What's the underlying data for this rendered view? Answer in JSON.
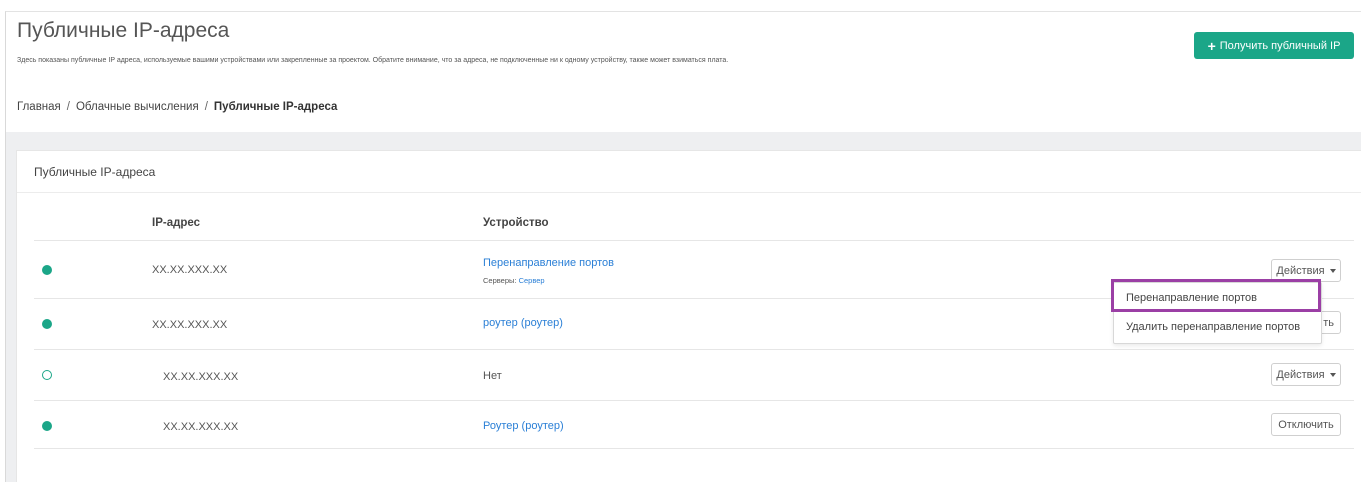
{
  "page": {
    "title": "Публичные IP-адреса",
    "description": "Здесь показаны публичные IP адреса, используемые вашими устройствами или закрепленные за проектом. Обратите внимание, что за адреса, не подключенные ни к одному устройству, также может взиматься плата.",
    "get_ip_button": "Получить публичный IP"
  },
  "breadcrumb": {
    "items": [
      "Главная",
      "Облачные вычисления",
      "Публичные IP-адреса"
    ],
    "separator": "/"
  },
  "panel": {
    "title": "Публичные IP-адреса",
    "columns": [
      "IP-адрес",
      "Устройство"
    ]
  },
  "rows": [
    {
      "status": "active",
      "ip": "XX.XX.XXX.XX",
      "device": "Перенаправление портов",
      "device_sub_label": "Серверы:",
      "device_sub_link": "Сервер",
      "action": "Действия"
    },
    {
      "status": "active",
      "ip": "XX.XX.XXX.XX",
      "device": "роутер (роутер)",
      "action": "ть"
    },
    {
      "status": "inactive",
      "ip": "XX.XX.XXX.XX",
      "device": "Нет",
      "action": "Действия"
    },
    {
      "status": "active",
      "ip": "XX.XX.XXX.XX",
      "device": "Роутер (роутер)",
      "action": "Отключить"
    }
  ],
  "dropdown": {
    "items": [
      "Перенаправление портов",
      "Удалить перенаправление портов"
    ],
    "highlighted_index": 0
  },
  "colors": {
    "accent": "#1ba688",
    "link": "#2a7fd6",
    "highlight": "#9b3fa5"
  }
}
